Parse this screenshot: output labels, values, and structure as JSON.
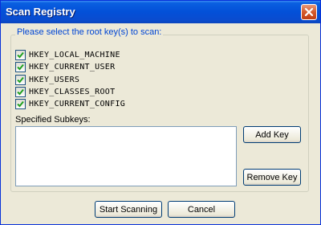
{
  "window": {
    "title": "Scan Registry"
  },
  "group": {
    "caption": "Please select the root key(s) to scan:"
  },
  "root_keys": [
    {
      "label": "HKEY_LOCAL_MACHINE",
      "checked": true
    },
    {
      "label": "HKEY_CURRENT_USER",
      "checked": true
    },
    {
      "label": "HKEY_USERS",
      "checked": true
    },
    {
      "label": "HKEY_CLASSES_ROOT",
      "checked": true
    },
    {
      "label": "HKEY_CURRENT_CONFIG",
      "checked": true
    }
  ],
  "subkeys": {
    "label": "Specified Subkeys:",
    "items": []
  },
  "buttons": {
    "add_key": "Add Key",
    "remove_key": "Remove Key",
    "start_scanning": "Start Scanning",
    "cancel": "Cancel"
  },
  "icons": {
    "close": "close-icon",
    "check": "checkmark-icon"
  },
  "colors": {
    "title_bar": "#0350d8",
    "caption_text": "#0046d5",
    "check_mark": "#21a121",
    "close_button": "#d55a2b"
  }
}
